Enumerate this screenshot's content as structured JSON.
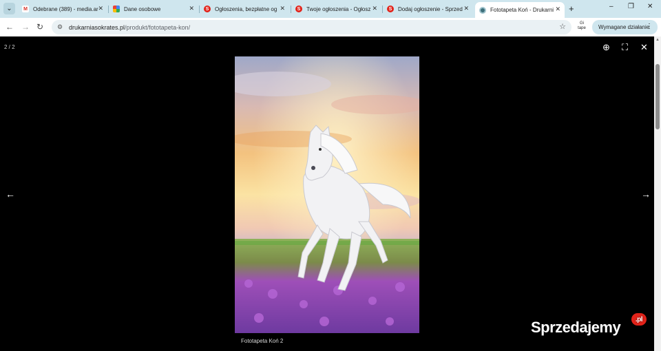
{
  "browser": {
    "tabs": [
      {
        "title": "Odebrane (389) - media.ar",
        "favicon": "gmail-icon",
        "active": false
      },
      {
        "title": "Dane osobowe",
        "favicon": "google-icon",
        "active": false
      },
      {
        "title": "Ogłoszenia, bezpłatne og",
        "favicon": "sprzedajemy-icon",
        "active": false
      },
      {
        "title": "Twoje ogłoszenia - Ogłosz",
        "favicon": "sprzedajemy-icon",
        "active": false
      },
      {
        "title": "Dodaj ogłoszenie - Sprzed",
        "favicon": "sprzedajemy-icon",
        "active": false
      },
      {
        "title": "Fototapeta Koń - Drukarni",
        "favicon": "globe-icon",
        "active": true
      }
    ],
    "url_host": "drukarniasokrates.pl",
    "url_path": "/produkt/fototapeta-kon/",
    "toolbar_icon_text": "Gi tape",
    "action_button_label": "Wymagane działanie"
  },
  "viewer": {
    "counter": "2 / 2",
    "caption": "Fototapeta Koń 2"
  },
  "watermark": {
    "text": "Sprzedajemy",
    "suffix": ".pl"
  },
  "colors": {
    "tabstrip": "#cfe6ee",
    "viewer_bg": "#000000",
    "brand_red": "#e2231a"
  }
}
